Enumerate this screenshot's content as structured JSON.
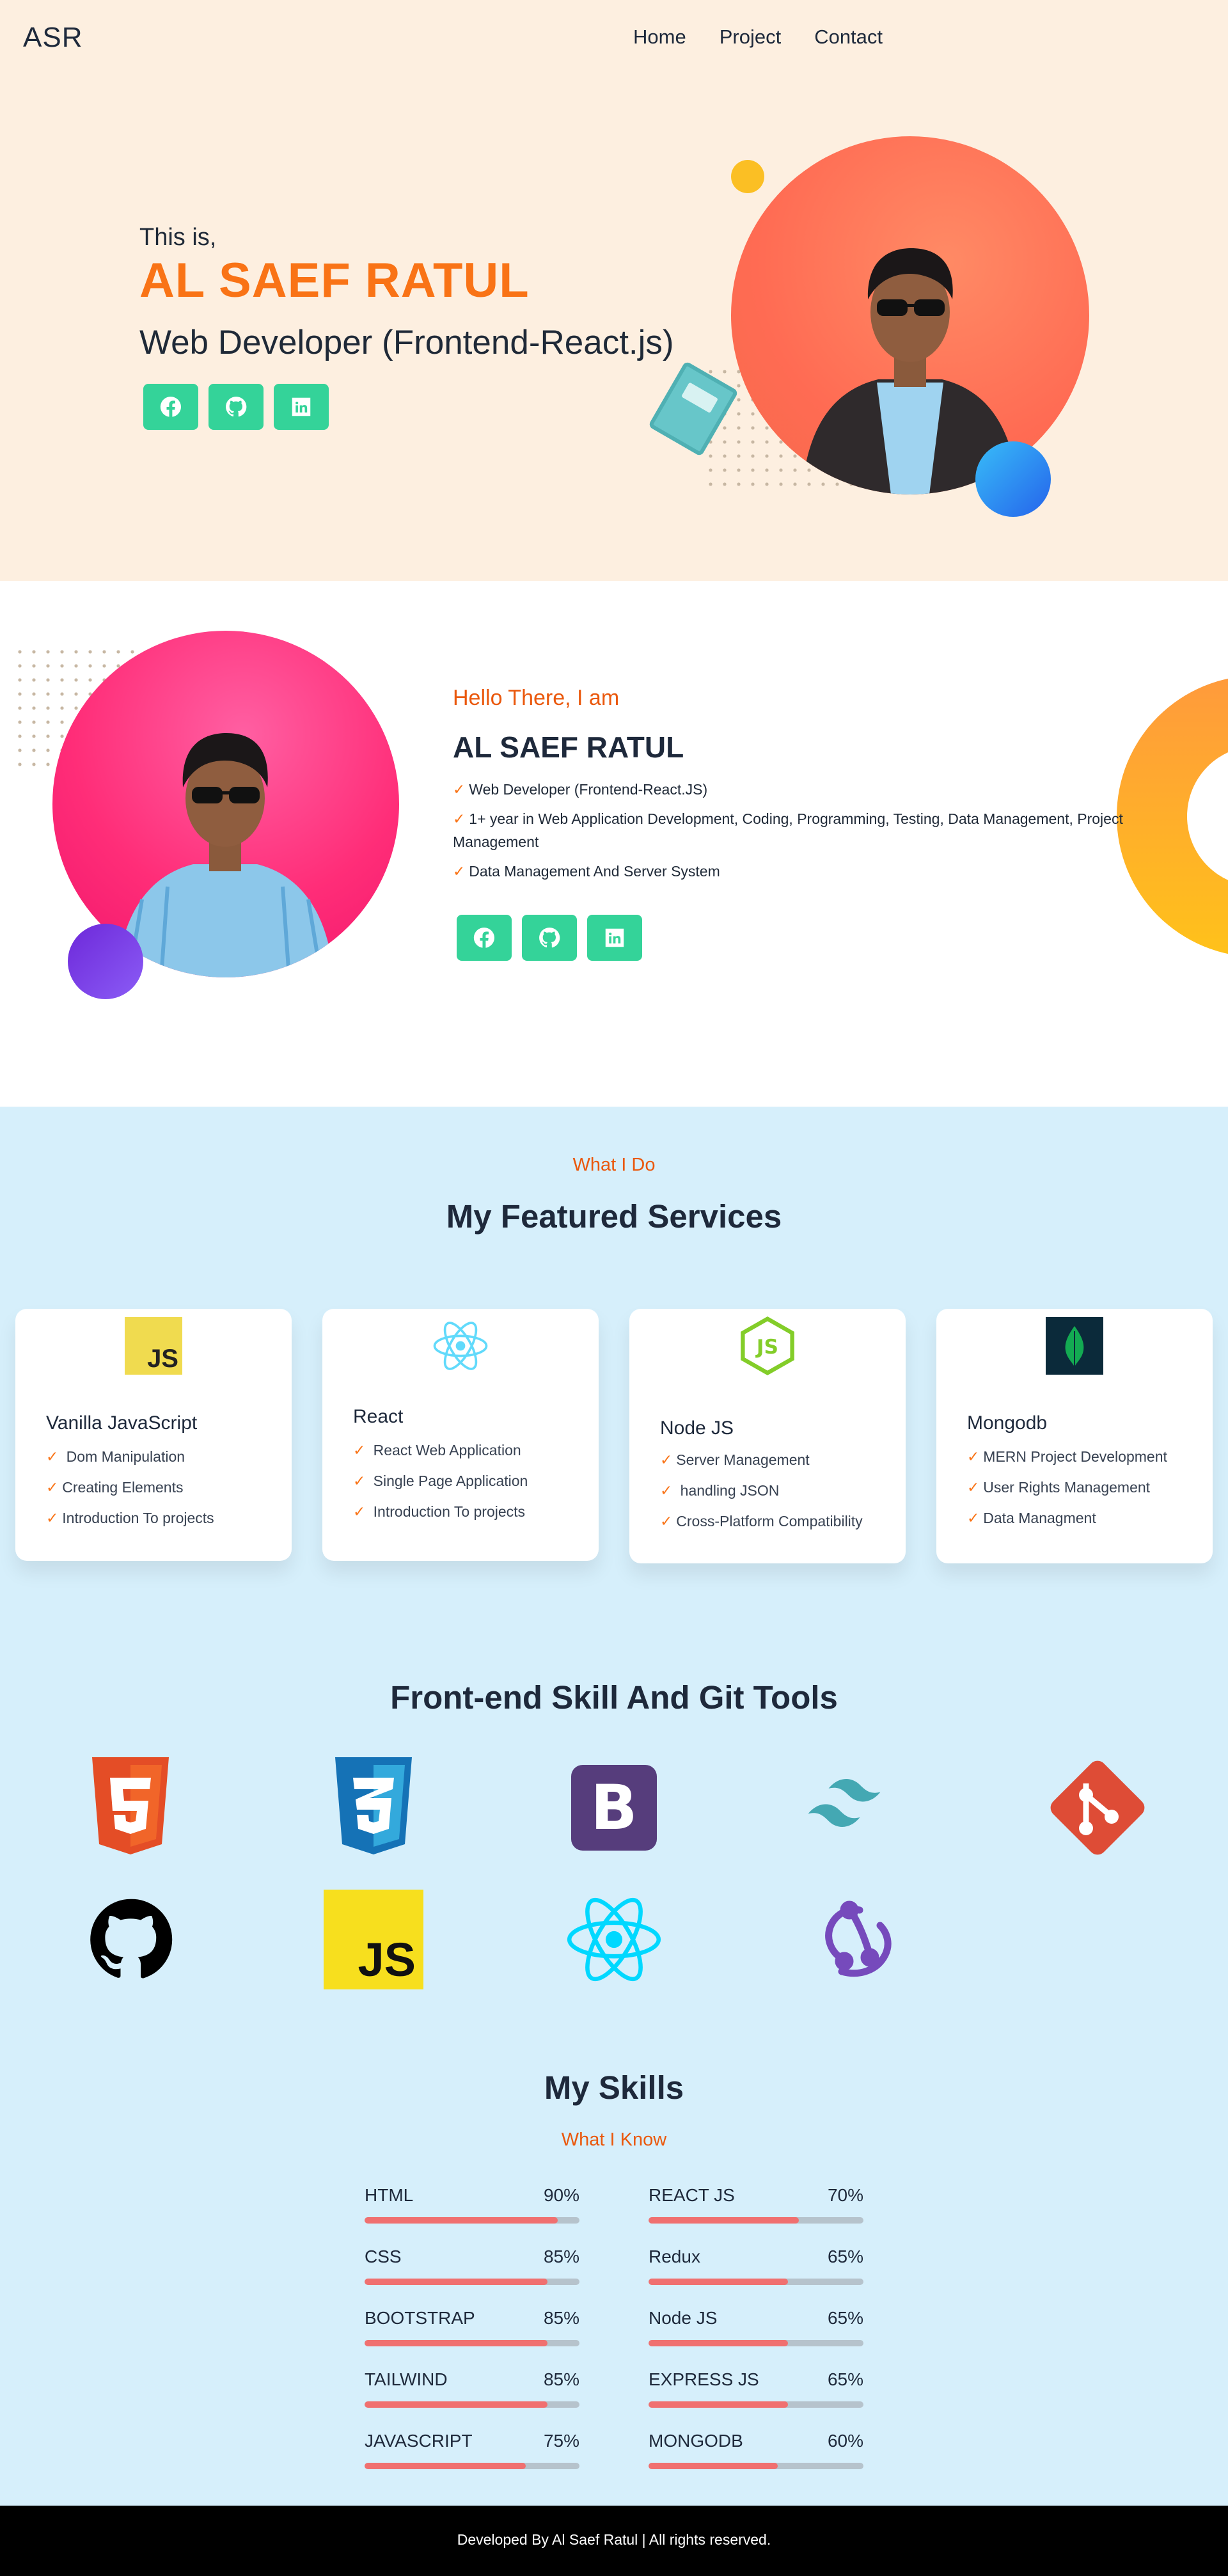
{
  "nav": {
    "logo": "ASR",
    "links": [
      "Home",
      "Project",
      "Contact"
    ]
  },
  "hero": {
    "intro": "This is,",
    "name": "AL SAEF RATUL",
    "role": "Web Developer (Frontend-React.js)"
  },
  "social": {
    "icons": [
      "facebook-icon",
      "github-icon",
      "linkedin-icon"
    ]
  },
  "about": {
    "hello": "Hello There, I am",
    "name": "AL SAEF RATUL",
    "points": [
      "Web Developer (Frontend-React.JS)",
      "1+ year in Web Application Development, Coding, Programming, Testing, Data Management, Project Management",
      "Data Management And Server System"
    ]
  },
  "check_mark": "✓",
  "services": {
    "eyebrow": "What I Do",
    "title": "My Featured Services",
    "cards": [
      {
        "title": "Vanilla JavaScript",
        "icon": "javascript-icon",
        "items": [
          " Dom Manipulation",
          "Creating Elements",
          "Introduction To projects"
        ]
      },
      {
        "title": "React",
        "icon": "react-icon",
        "items": [
          " React Web Application",
          " Single Page Application",
          " Introduction To projects"
        ]
      },
      {
        "title": "Node JS",
        "icon": "nodejs-icon",
        "items": [
          "Server Management",
          " handling JSON",
          "Cross-Platform Compatibility"
        ]
      },
      {
        "title": "Mongodb",
        "icon": "mongodb-icon",
        "items": [
          "MERN Project Development",
          "User Rights Management",
          "Data Managment"
        ]
      }
    ]
  },
  "tools": {
    "title": "Front-end Skill And Git Tools",
    "icons": [
      "html5-icon",
      "css3-icon",
      "bootstrap-icon",
      "tailwind-icon",
      "git-icon",
      "github-icon",
      "javascript-icon",
      "react-icon",
      "redux-icon"
    ],
    "js_text": "JS",
    "bootstrap_text": "B"
  },
  "skills": {
    "title": "My Skills",
    "subtitle": "What I Know",
    "left": [
      {
        "name": "HTML",
        "percent": "90%",
        "value": 90
      },
      {
        "name": "CSS",
        "percent": "85%",
        "value": 85
      },
      {
        "name": "BOOTSTRAP",
        "percent": "85%",
        "value": 85
      },
      {
        "name": "TAILWIND",
        "percent": "85%",
        "value": 85
      },
      {
        "name": "JAVASCRIPT",
        "percent": "75%",
        "value": 75
      }
    ],
    "right": [
      {
        "name": "REACT JS",
        "percent": "70%",
        "value": 70
      },
      {
        "name": "Redux",
        "percent": "65%",
        "value": 65
      },
      {
        "name": "Node JS",
        "percent": "65%",
        "value": 65
      },
      {
        "name": "EXPRESS JS",
        "percent": "65%",
        "value": 65
      },
      {
        "name": "MONGODB",
        "percent": "60%",
        "value": 60
      }
    ]
  },
  "footer": {
    "text": "Developed By Al Saef Ratul | All rights reserved."
  }
}
